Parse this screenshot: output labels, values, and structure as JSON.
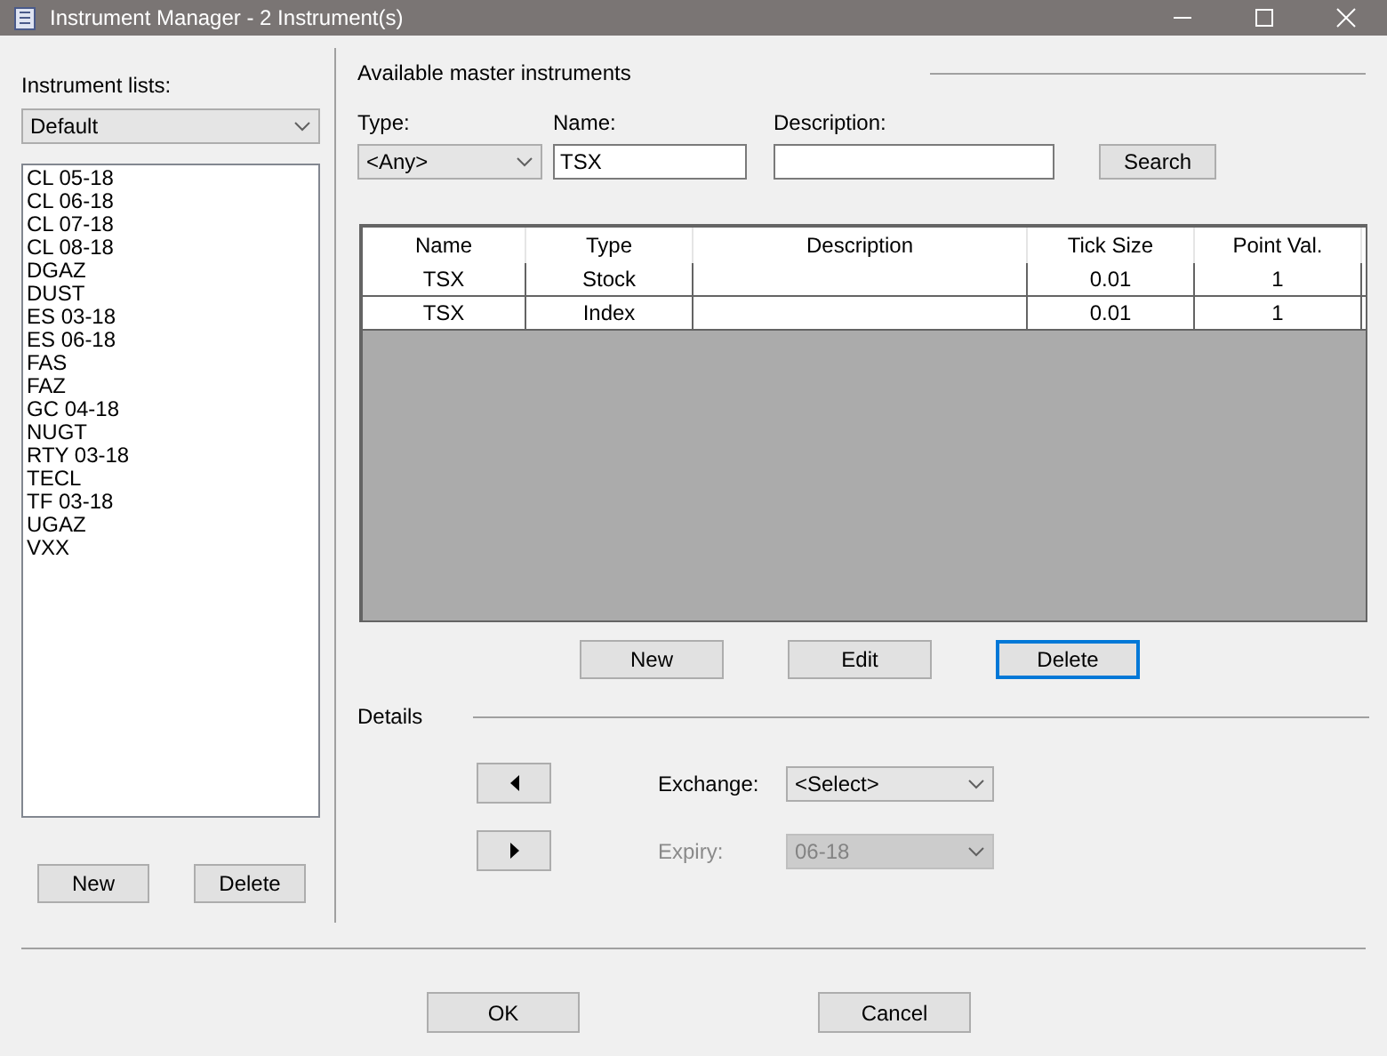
{
  "window": {
    "title": "Instrument Manager - 2 Instrument(s)"
  },
  "instrument_lists": {
    "label": "Instrument lists:",
    "dropdown": "Default",
    "items": [
      {
        "text": "CL 05-18",
        "selected": false
      },
      {
        "text": "CL 06-18",
        "selected": false
      },
      {
        "text": "CL 07-18",
        "selected": false
      },
      {
        "text": "CL 08-18",
        "selected": false
      },
      {
        "text": "DGAZ",
        "selected": false
      },
      {
        "text": "DUST",
        "selected": false
      },
      {
        "text": "ES 03-18",
        "selected": false
      },
      {
        "text": "ES 06-18",
        "selected": false
      },
      {
        "text": "FAS",
        "selected": false
      },
      {
        "text": "FAZ",
        "selected": false
      },
      {
        "text": "GC 04-18",
        "selected": false
      },
      {
        "text": "NUGT",
        "selected": false
      },
      {
        "text": "RTY 03-18",
        "selected": false
      },
      {
        "text": "TECL",
        "selected": false
      },
      {
        "text": "TF 03-18",
        "selected": false
      },
      {
        "text": "UGAZ",
        "selected": false
      },
      {
        "text": "VXX",
        "selected": false
      }
    ],
    "buttons": [
      {
        "label": "New",
        "focused": false
      },
      {
        "label": "Delete",
        "focused": false
      }
    ]
  },
  "master": {
    "title": "Available master instruments",
    "type_label": "Type:",
    "type_value": "<Any>",
    "name_label": "Name:",
    "name_value": "TSX",
    "description_label": "Description:",
    "search_button": "Search",
    "table": {
      "columns": [
        "Name",
        "Type",
        "Description",
        "Tick Size",
        "Point Val."
      ],
      "rows": [
        [
          "TSX",
          "Stock",
          "",
          "0.01",
          "1"
        ],
        [
          "TSX",
          "Index",
          "",
          "0.01",
          "1"
        ]
      ]
    },
    "buttons": [
      {
        "label": "New",
        "focused": false
      },
      {
        "label": "Edit",
        "focused": false
      },
      {
        "label": "Delete",
        "focused": true
      }
    ]
  },
  "details": {
    "title": "Details",
    "exchange": {
      "label": "Exchange:",
      "value": "<Select>",
      "disabled": false
    },
    "expiry": {
      "label": "Expiry:",
      "value": "06-18",
      "disabled": true
    }
  },
  "dialog_buttons": [
    {
      "label": "OK",
      "focused": false
    },
    {
      "label": "Cancel",
      "focused": false
    }
  ]
}
